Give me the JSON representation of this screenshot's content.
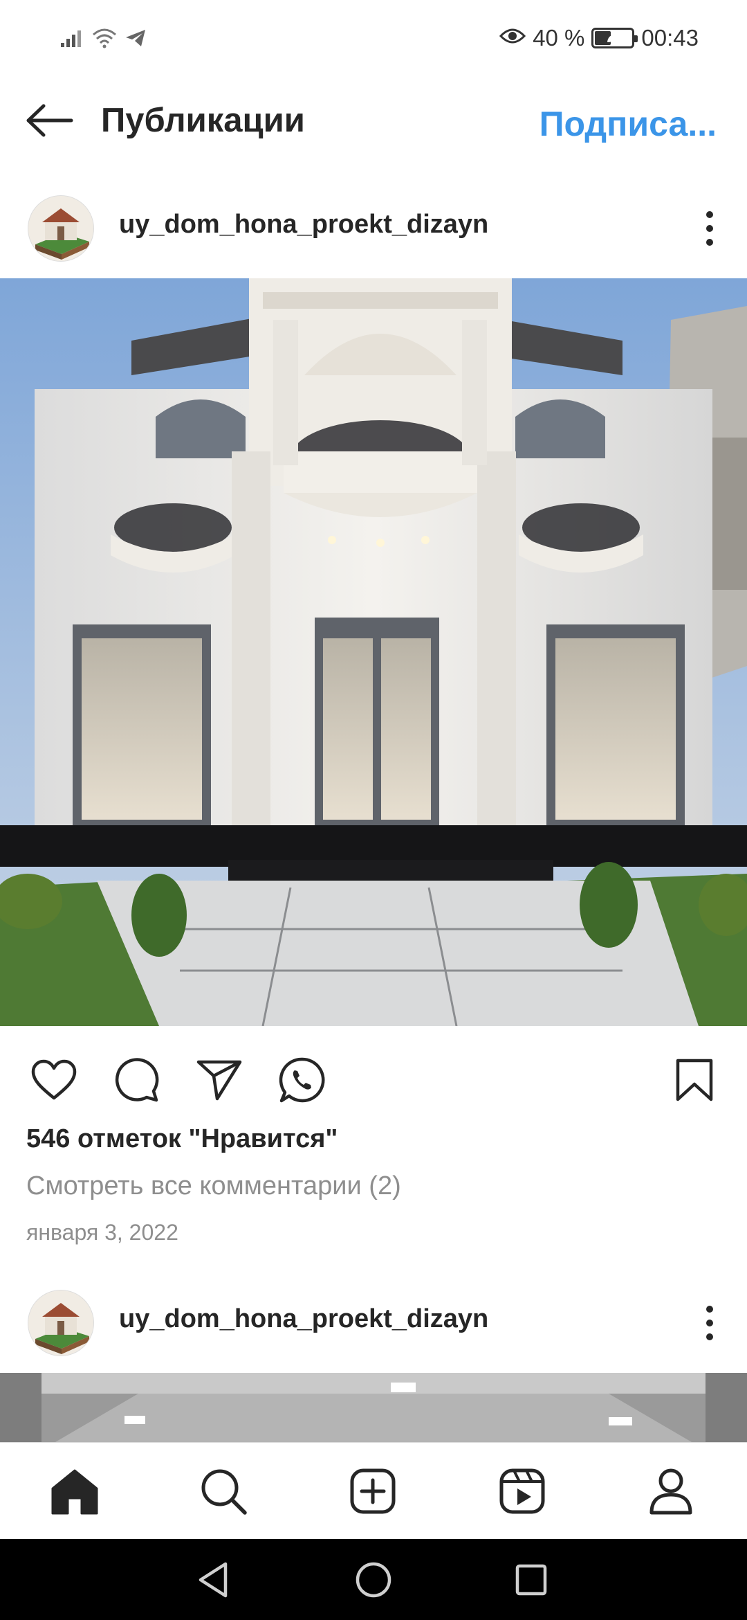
{
  "status_bar": {
    "battery_percent_label": "40 %",
    "battery_level": 0.4,
    "time": "00:43",
    "icons": [
      "signal-icon",
      "wifi-icon",
      "telegram-icon",
      "eye-icon",
      "battery-icon"
    ]
  },
  "header": {
    "title": "Публикации",
    "follow_label": "Подписа..."
  },
  "posts": [
    {
      "username": "uy_dom_hona_proekt_dizayn",
      "likes_text": "546 отметок \"Нравится\"",
      "comments_text": "Смотреть все комментарии (2)",
      "date": "января 3, 2022"
    },
    {
      "username": "uy_dom_hona_proekt_dizayn"
    }
  ],
  "actions": {
    "icons": [
      "heart-icon",
      "comment-icon",
      "share-icon",
      "whatsapp-icon",
      "bookmark-icon"
    ]
  },
  "tabbar": {
    "icons": [
      "home-icon",
      "search-icon",
      "new-post-icon",
      "reels-icon",
      "profile-icon"
    ],
    "active": "home-icon"
  },
  "system_nav": {
    "icons": [
      "back-triangle-icon",
      "home-circle-icon",
      "recents-square-icon"
    ]
  },
  "colors": {
    "accent": "#3b95e8",
    "text": "#262626",
    "muted": "#8e8e8e"
  }
}
